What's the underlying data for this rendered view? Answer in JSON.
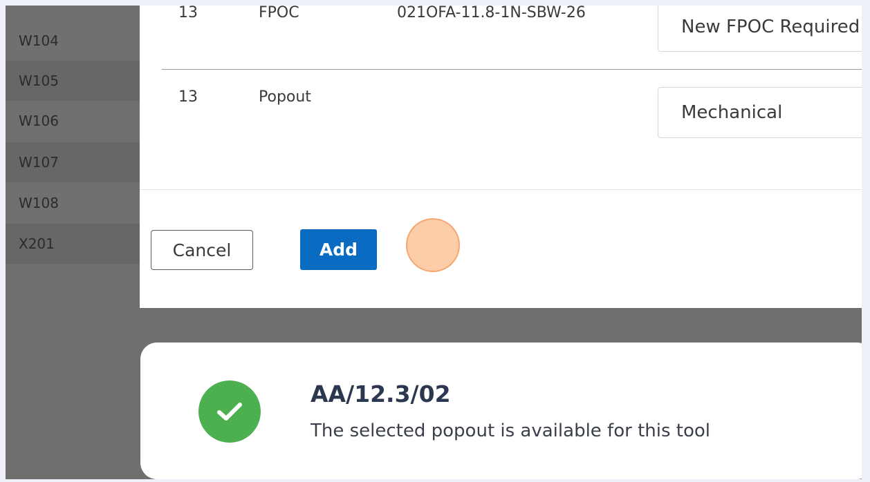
{
  "sidebar": {
    "items": [
      {
        "label": "W104"
      },
      {
        "label": "W105"
      },
      {
        "label": "W106"
      },
      {
        "label": "W107"
      },
      {
        "label": "W108"
      },
      {
        "label": "X201"
      }
    ]
  },
  "modal": {
    "rows": [
      {
        "qty": "13",
        "type": "FPOC",
        "code": "021OFA-11.8-1N-SBW-26",
        "selection": "New FPOC Required"
      },
      {
        "qty": "13",
        "type": "Popout",
        "code": "",
        "selection": "Mechanical"
      }
    ],
    "cancel_label": "Cancel",
    "add_label": "Add"
  },
  "toast": {
    "title": "AA/12.3/02",
    "message": "The selected popout is available for this tool",
    "icon": "check-circle-icon",
    "icon_color": "#4cb04f"
  },
  "colors": {
    "primary": "#0a6bc2",
    "overlay": "#6f6f6f",
    "success": "#4cb04f",
    "click_marker": "#fdcca9"
  }
}
